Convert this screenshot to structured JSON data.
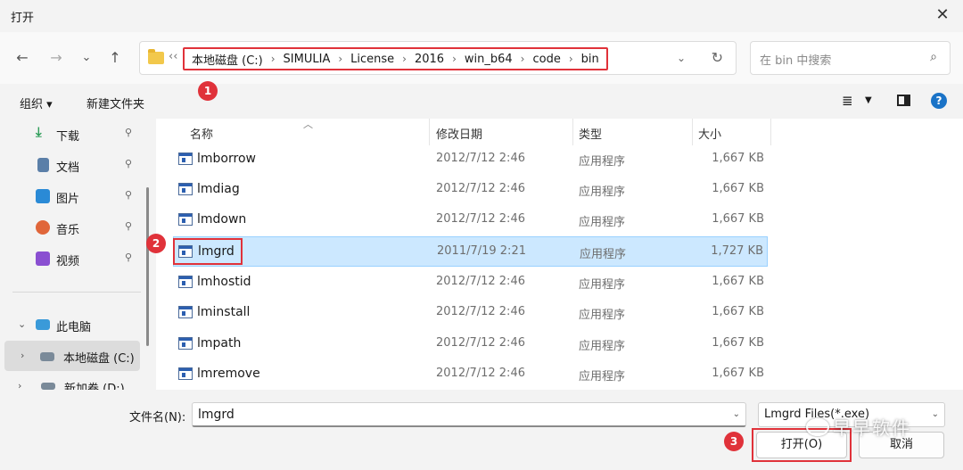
{
  "window": {
    "title": "打开",
    "close_glyph": "✕"
  },
  "nav": {
    "back": "←",
    "forward": "→",
    "recent": "⌄",
    "up": "↑"
  },
  "address": {
    "overflow": "‹‹",
    "crumbs": [
      "本地磁盘 (C:)",
      "SIMULIA",
      "License",
      "2016",
      "win_b64",
      "code",
      "bin"
    ],
    "separator": "›",
    "dropdown": "⌄",
    "refresh": "↻"
  },
  "search": {
    "placeholder": "在 bin 中搜索",
    "icon": "⌕"
  },
  "toolbar": {
    "organize": "组织 ▾",
    "new_folder": "新建文件夹",
    "view": "≣",
    "view_dd": "▼",
    "help": "?"
  },
  "sidebar": {
    "items": [
      {
        "label": "下载",
        "pin": "📌",
        "color": "#2f9e5a"
      },
      {
        "label": "文档",
        "pin": "📌",
        "color": "#5b7fa8"
      },
      {
        "label": "图片",
        "pin": "📌",
        "color": "#2a8ad6"
      },
      {
        "label": "音乐",
        "pin": "📌",
        "color": "#e0663a"
      },
      {
        "label": "视频",
        "pin": "📌",
        "color": "#8a4fd1"
      }
    ],
    "this_pc": "此电脑",
    "local_disk": "本地磁盘 (C:)",
    "new_volume": "新加卷 (D:)",
    "expand_open": "⌄",
    "expand_closed": "›"
  },
  "columns": {
    "name": "名称",
    "modified": "修改日期",
    "type": "类型",
    "size": "大小",
    "sort_caret": "︿"
  },
  "files": [
    {
      "name": "lmborrow",
      "date": "2012/7/12 2:46",
      "type": "应用程序",
      "size": "1,667 KB"
    },
    {
      "name": "lmdiag",
      "date": "2012/7/12 2:46",
      "type": "应用程序",
      "size": "1,667 KB"
    },
    {
      "name": "lmdown",
      "date": "2012/7/12 2:46",
      "type": "应用程序",
      "size": "1,667 KB"
    },
    {
      "name": "lmgrd",
      "date": "2011/7/19 2:21",
      "type": "应用程序",
      "size": "1,727 KB"
    },
    {
      "name": "lmhostid",
      "date": "2012/7/12 2:46",
      "type": "应用程序",
      "size": "1,667 KB"
    },
    {
      "name": "lminstall",
      "date": "2012/7/12 2:46",
      "type": "应用程序",
      "size": "1,667 KB"
    },
    {
      "name": "lmpath",
      "date": "2012/7/12 2:46",
      "type": "应用程序",
      "size": "1,667 KB"
    },
    {
      "name": "lmremove",
      "date": "2012/7/12 2:46",
      "type": "应用程序",
      "size": "1,667 KB"
    }
  ],
  "bottom": {
    "filename_label": "文件名(N):",
    "filename_value": "lmgrd",
    "filter_value": "Lmgrd Files(*.exe)",
    "dropdown": "⌄",
    "open_label": "打开(O)",
    "cancel_label": "取消"
  },
  "badges": [
    "1",
    "2",
    "3"
  ],
  "watermark": "早早软件"
}
